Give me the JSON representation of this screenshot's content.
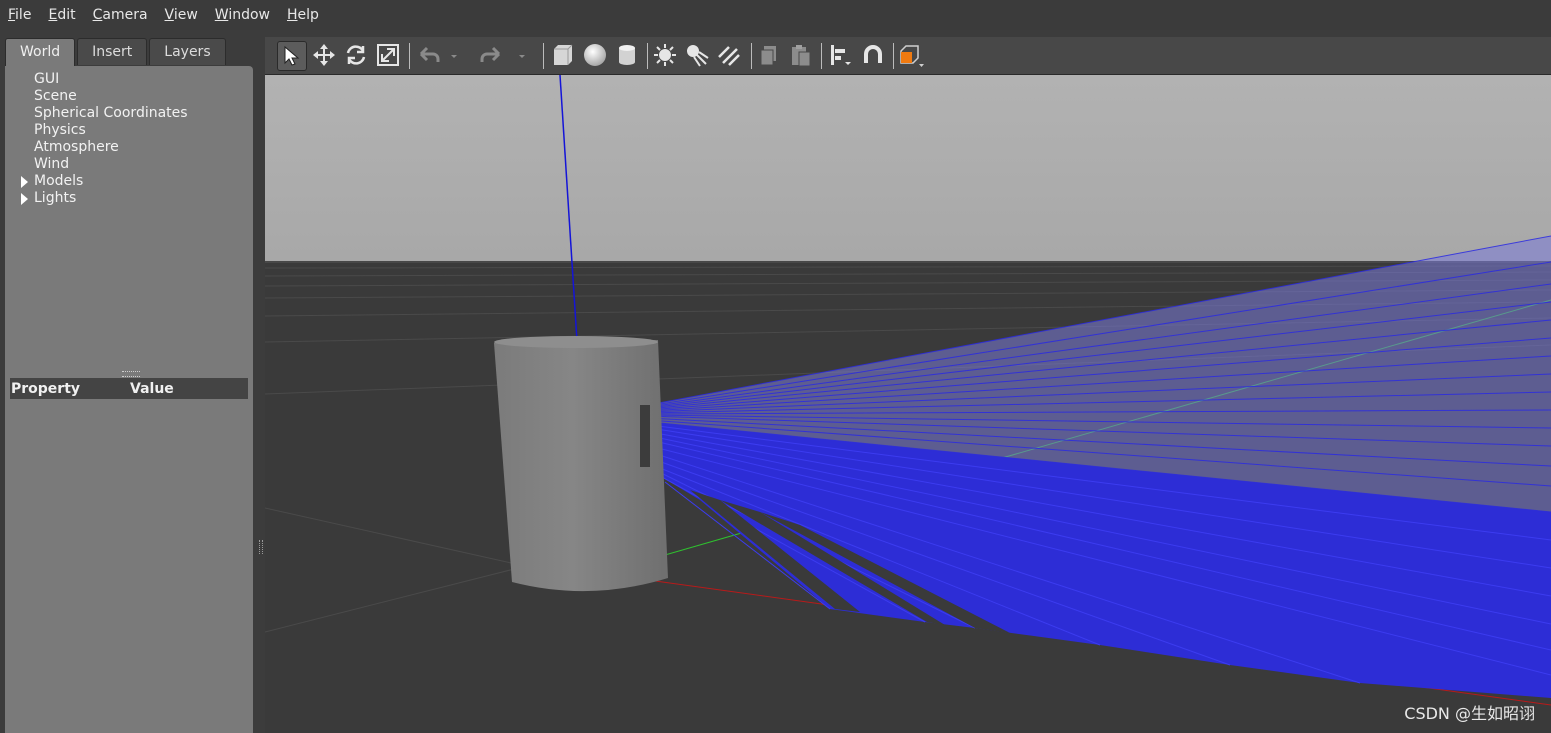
{
  "menu": [
    {
      "label": "File",
      "accel": "F",
      "rest": "ile"
    },
    {
      "label": "Edit",
      "accel": "E",
      "rest": "dit"
    },
    {
      "label": "Camera",
      "accel": "C",
      "rest": "amera"
    },
    {
      "label": "View",
      "accel": "V",
      "rest": "iew"
    },
    {
      "label": "Window",
      "accel": "W",
      "rest": "indow"
    },
    {
      "label": "Help",
      "accel": "H",
      "rest": "elp"
    }
  ],
  "tabs": {
    "world": "World",
    "insert": "Insert",
    "layers": "Layers"
  },
  "tree": {
    "gui": "GUI",
    "scene": "Scene",
    "spherical": "Spherical Coordinates",
    "physics": "Physics",
    "atmosphere": "Atmosphere",
    "wind": "Wind",
    "models": "Models",
    "lights": "Lights"
  },
  "properties": {
    "col_property": "Property",
    "col_value": "Value"
  },
  "toolbar_icons": [
    "select-arrow-icon",
    "translate-icon",
    "rotate-icon",
    "scale-icon",
    "undo-icon",
    "undo-dropdown-icon",
    "redo-icon",
    "redo-dropdown-icon",
    "box-icon",
    "sphere-icon",
    "cylinder-icon",
    "point-light-icon",
    "spot-light-icon",
    "directional-light-icon",
    "copy-icon",
    "paste-icon",
    "align-icon",
    "snap-magnet-icon",
    "view-angle-icon"
  ],
  "colors": {
    "laser": "#2a2ae0",
    "accent": "#f07a10"
  },
  "watermark": "CSDN @生如昭诩"
}
